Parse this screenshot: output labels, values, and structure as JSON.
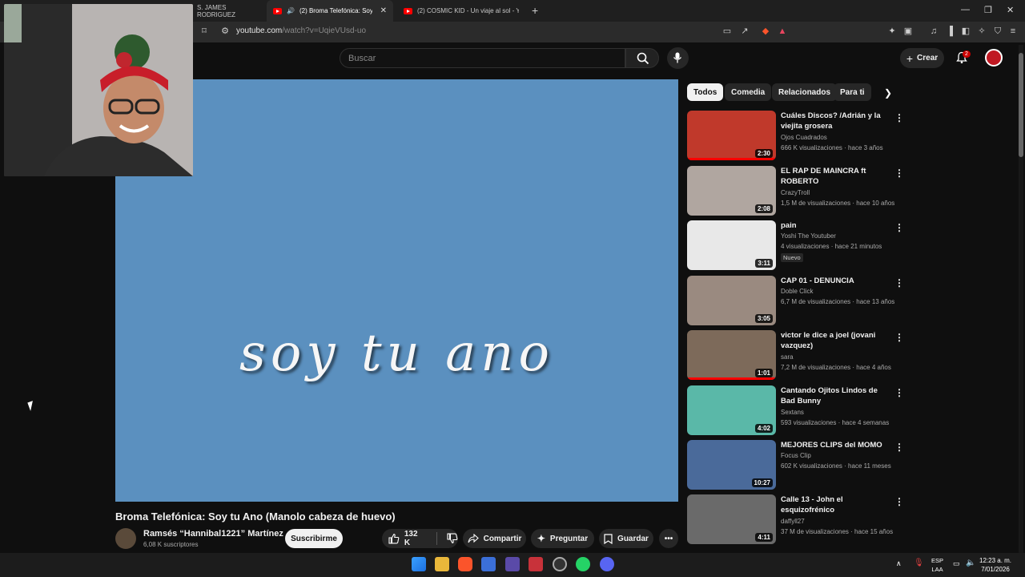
{
  "browser": {
    "tabs": [
      {
        "label": "S. JAMES RODRIGUEZ"
      },
      {
        "label": "(2) Broma Telefónica: Soy tu A"
      },
      {
        "label": "(2) COSMIC KID - Un viaje al sol - Yo"
      }
    ],
    "url_host": "youtube.com",
    "url_path": "/watch?v=UqieVUsd-uo"
  },
  "header": {
    "search_placeholder": "Buscar",
    "create_label": "Crear",
    "notification_count": "2"
  },
  "video": {
    "overlay_text": "soy tu ano",
    "title": "Broma Telefónica: Soy tu Ano (Manolo cabeza de huevo)",
    "channel": "Ramsés “Hannibal1221” Martínez",
    "subscribers": "6,08 K suscriptores",
    "subscribe_label": "Suscribirme",
    "likes": "132 K",
    "share_label": "Compartir",
    "ask_label": "Preguntar",
    "save_label": "Guardar",
    "player_color": "#5b90bf"
  },
  "chips": [
    "Todos",
    "Comedia",
    "Relacionados",
    "Para ti"
  ],
  "recommendations": [
    {
      "title": "Cuáles Discos? /Adrián y la viejita grosera",
      "channel": "Ojos Cuadrados",
      "meta": "666 K visualizaciones · hace 3 años",
      "duration": "2:30",
      "watched": 1.0,
      "color": "#c0392b"
    },
    {
      "title": "EL RAP DE MAINCRA ft ROBERTO",
      "channel": "CrazyTroll",
      "meta": "1,5 M de visualizaciones · hace 10 años",
      "duration": "2:08",
      "watched": 0,
      "color": "#b0a6a0"
    },
    {
      "title": "pain",
      "channel": "Yoshi The Youtuber",
      "meta": "4 visualizaciones · hace 21 minutos",
      "badge": "Nuevo",
      "duration": "3:11",
      "watched": 0,
      "color": "#e8e8e8"
    },
    {
      "title": "CAP 01 - DENUNCIA",
      "channel": "Doble Click",
      "meta": "6,7 M de visualizaciones · hace 13 años",
      "duration": "3:05",
      "watched": 0,
      "color": "#9a8a80"
    },
    {
      "title": "victor le dice a joel (jovani vazquez)",
      "channel": "sara",
      "meta": "7,2 M de visualizaciones · hace 4 años",
      "duration": "1:01",
      "watched": 1.0,
      "color": "#7d6a5a"
    },
    {
      "title": "Cantando Ojitos Lindos de Bad Bunny",
      "channel": "Sextans",
      "meta": "593 visualizaciones · hace 4 semanas",
      "duration": "4:02",
      "watched": 0,
      "color": "#5ab8a8"
    },
    {
      "title": "MEJORES CLIPS del MOMO",
      "channel": "Focus Clip",
      "meta": "602 K visualizaciones · hace 11 meses",
      "duration": "10:27",
      "watched": 0,
      "color": "#4a6a9a"
    },
    {
      "title": "Calle 13 - John el esquizofrénico",
      "channel": "daffyll27",
      "meta": "37 M de visualizaciones · hace 15 años",
      "duration": "4:11",
      "watched": 0,
      "color": "#6a6a6a"
    }
  ],
  "taskbar": {
    "lang_top": "ESP",
    "lang_bottom": "LAA",
    "time": "12:23 a. m.",
    "date": "7/01/2026"
  }
}
